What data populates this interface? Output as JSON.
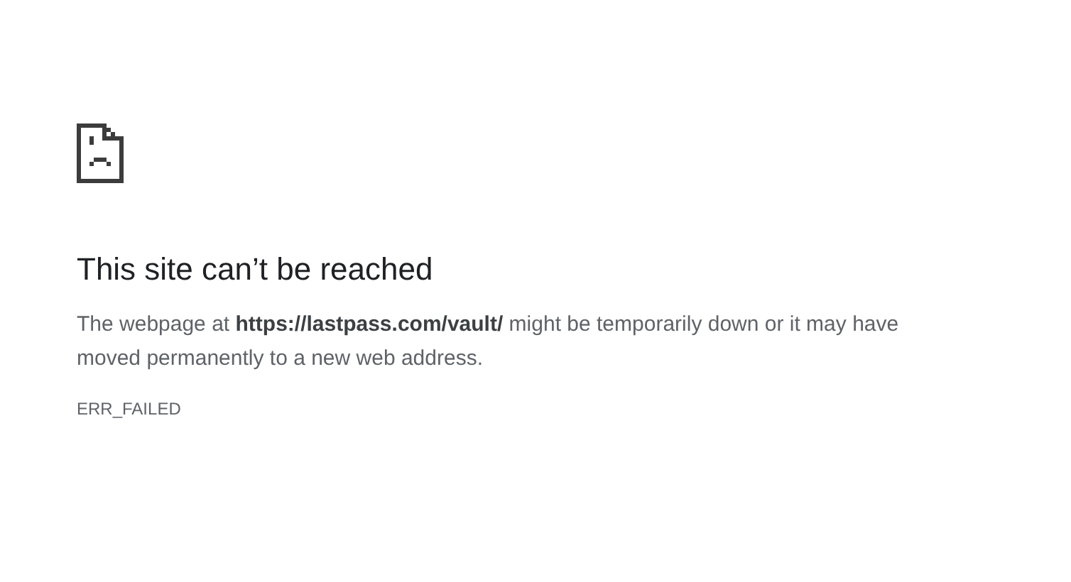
{
  "heading": "This site can’t be reached",
  "message": "The webpage at **https://lastpass.com/vault/** might be temporarily down or it may have moved permanently to a new web address.",
  "error_code": "ERR_FAILED"
}
